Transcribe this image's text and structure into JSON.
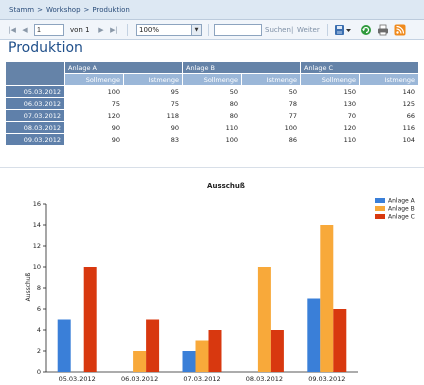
{
  "breadcrumb": [
    "Stamm",
    "Workshop",
    "Produktion"
  ],
  "breadcrumb_sep": ">",
  "toolbar": {
    "first_icon": "|◀",
    "prev_icon": "◀",
    "page_value": "1",
    "page_of": "von 1",
    "next_icon": "▶",
    "last_icon": "▶|",
    "zoom": "100%",
    "search_placeholder": "",
    "search_label": "Suchen",
    "search_sep": "|",
    "next_label": "Weiter",
    "icons": [
      "export-icon",
      "refresh-icon",
      "print-icon",
      "feed-icon"
    ],
    "colors": {
      "export": "#3b6fb0",
      "refresh": "#2e9a3c",
      "print": "#6b6b6b",
      "feed": "#f08a1c"
    }
  },
  "page_title": "Produktion",
  "table": {
    "groups": [
      "Anlage A",
      "Anlage B",
      "Anlage C"
    ],
    "subheaders": [
      "Sollmenge",
      "Istmenge",
      "Sollmenge",
      "Istmenge",
      "Sollmenge",
      "Istmenge"
    ],
    "rows": [
      {
        "date": "05.03.2012",
        "values": [
          "100",
          "95",
          "50",
          "50",
          "150",
          "140"
        ]
      },
      {
        "date": "06.03.2012",
        "values": [
          "75",
          "75",
          "80",
          "78",
          "130",
          "125"
        ]
      },
      {
        "date": "07.03.2012",
        "values": [
          "120",
          "118",
          "80",
          "77",
          "70",
          "66"
        ]
      },
      {
        "date": "08.03.2012",
        "values": [
          "90",
          "90",
          "110",
          "100",
          "120",
          "116"
        ]
      },
      {
        "date": "09.03.2012",
        "values": [
          "90",
          "83",
          "100",
          "86",
          "110",
          "104"
        ]
      }
    ]
  },
  "chart_data": {
    "type": "bar",
    "title": "Ausschuß",
    "xlabel": "",
    "ylabel": "Ausschuß",
    "categories": [
      "05.03.2012",
      "06.03.2012",
      "07.03.2012",
      "08.03.2012",
      "09.03.2012"
    ],
    "series": [
      {
        "name": "Anlage A",
        "color": "#3a7fd8",
        "values": [
          5,
          0,
          2,
          0,
          7
        ]
      },
      {
        "name": "Anlage B",
        "color": "#f8a93a",
        "values": [
          0,
          2,
          3,
          10,
          14
        ]
      },
      {
        "name": "Anlage C",
        "color": "#d8380f",
        "values": [
          10,
          5,
          4,
          4,
          6
        ]
      }
    ],
    "ylim": [
      0,
      16
    ],
    "yticks": [
      "0",
      "2",
      "4",
      "6",
      "8",
      "10",
      "12",
      "14",
      "16"
    ],
    "grid": false,
    "legend_position": "top-right"
  }
}
